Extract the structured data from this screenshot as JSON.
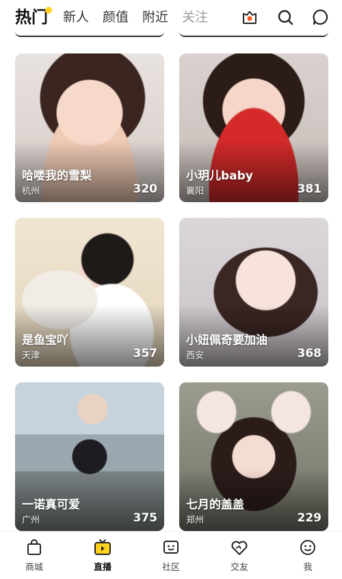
{
  "header": {
    "tabs": [
      {
        "label": "热门",
        "active": true
      },
      {
        "label": "新人"
      },
      {
        "label": "颜值"
      },
      {
        "label": "附近"
      },
      {
        "label": "关注"
      }
    ],
    "icons": [
      "live-camera-icon",
      "search-icon",
      "message-icon"
    ],
    "accent": "#ffd21f",
    "live_icon_color": "#ff5a1f"
  },
  "cards": [
    {
      "name": "哈喽我的雪梨",
      "city": "杭州",
      "count": "320"
    },
    {
      "name": "小玥儿baby",
      "city": "襄阳",
      "count": "381"
    },
    {
      "name": "是鱼宝吖",
      "city": "天津",
      "count": "357"
    },
    {
      "name": "小妞佩奇要加油",
      "city": "西安",
      "count": "368"
    },
    {
      "name": "一诺真可爱",
      "city": "广州",
      "count": "375"
    },
    {
      "name": "七月的盖盖",
      "city": "郑州",
      "count": "229"
    }
  ],
  "nav": [
    {
      "label": "商城",
      "icon": "shopping-bag-icon"
    },
    {
      "label": "直播",
      "icon": "live-tv-icon",
      "active": true
    },
    {
      "label": "社区",
      "icon": "community-icon"
    },
    {
      "label": "交友",
      "icon": "heart-icon"
    },
    {
      "label": "我",
      "icon": "profile-face-icon"
    }
  ]
}
